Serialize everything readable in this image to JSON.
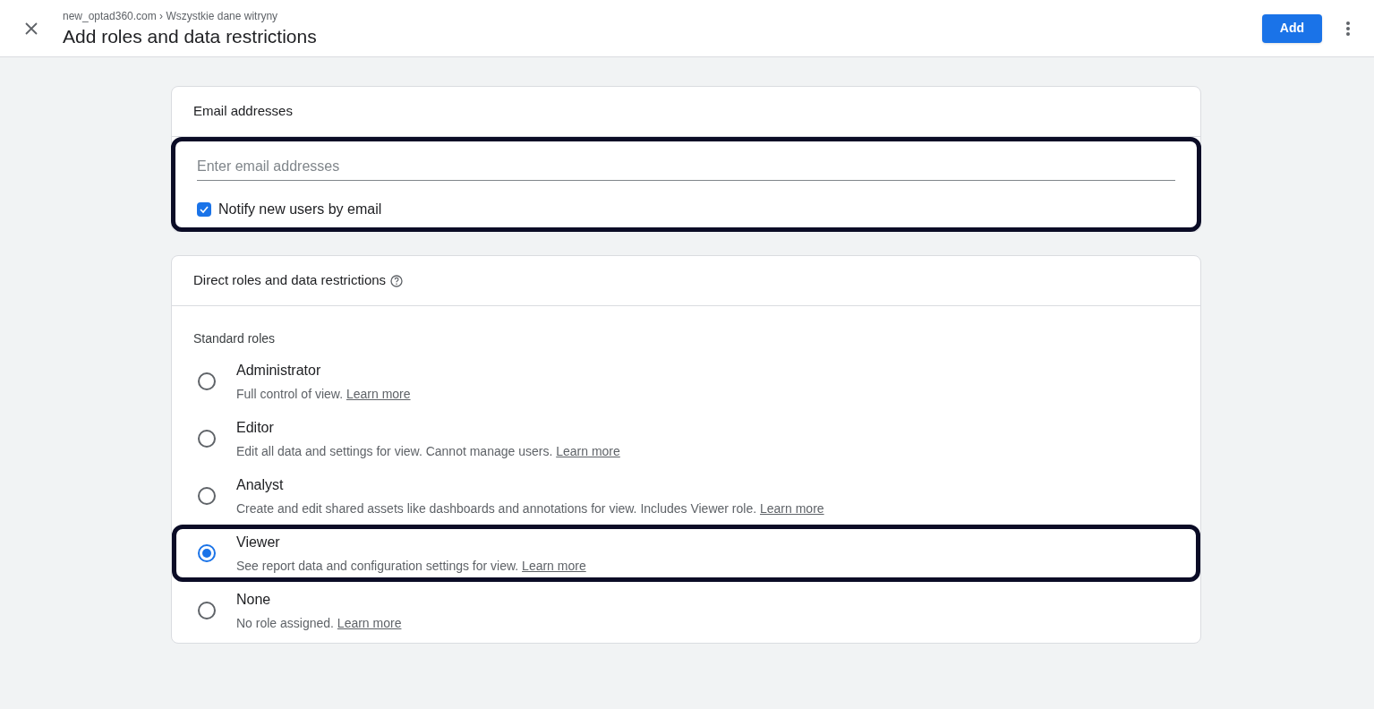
{
  "header": {
    "breadcrumb": "new_optad360.com › Wszystkie dane witryny",
    "title": "Add roles and data restrictions",
    "add_button": "Add"
  },
  "email_card": {
    "title": "Email addresses",
    "placeholder": "Enter email addresses",
    "highlighted": true,
    "notify": {
      "label": "Notify new users by email",
      "checked": true
    }
  },
  "roles_card": {
    "title": "Direct roles and data restrictions",
    "section_label": "Standard roles",
    "roles": [
      {
        "name": "Administrator",
        "description": "Full control of view.",
        "link": "Learn more",
        "selected": false,
        "highlighted": false
      },
      {
        "name": "Editor",
        "description": "Edit all data and settings for view. Cannot manage users.",
        "link": "Learn more",
        "selected": false,
        "highlighted": false
      },
      {
        "name": "Analyst",
        "description": "Create and edit shared assets like dashboards and annotations for view. Includes Viewer role.",
        "link": "Learn more",
        "selected": false,
        "highlighted": false
      },
      {
        "name": "Viewer",
        "description": "See report data and configuration settings for view.",
        "link": "Learn more",
        "selected": true,
        "highlighted": true
      },
      {
        "name": "None",
        "description": "No role assigned.",
        "link": "Learn more",
        "selected": false,
        "highlighted": false
      }
    ]
  }
}
